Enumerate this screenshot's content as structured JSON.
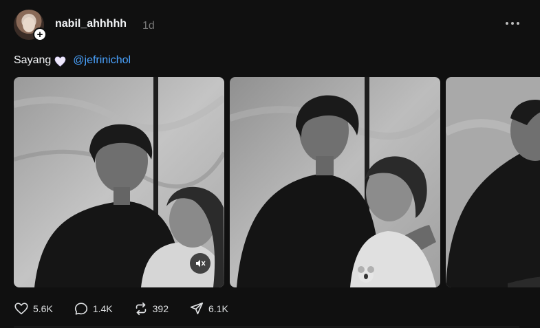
{
  "post": {
    "username": "nabil_ahhhhh",
    "time_ago": "1d",
    "caption_text": "Sayang",
    "caption_emoji": "white-heart",
    "mention": "@jefrinichol"
  },
  "media": {
    "count_visible": 3,
    "video_muted": true
  },
  "actions": {
    "likes": "5.6K",
    "replies": "1.4K",
    "reposts": "392",
    "shares": "6.1K"
  },
  "icons": [
    "heart-icon",
    "comment-icon",
    "repost-icon",
    "share-icon",
    "more-icon",
    "mute-icon",
    "plus-icon"
  ]
}
